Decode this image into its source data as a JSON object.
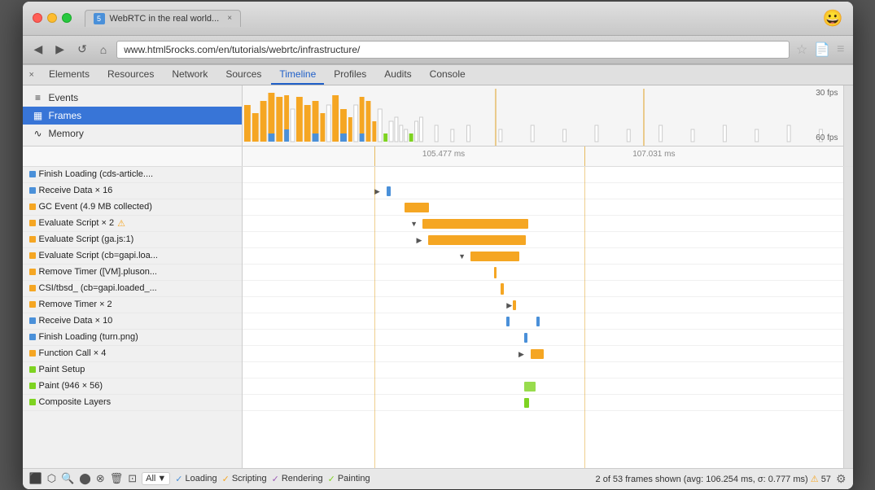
{
  "browser": {
    "tab_title": "WebRTC in the real world...",
    "tab_favicon": "5",
    "url": "www.html5rocks.com/en/tutorials/webrtc/infrastructure/",
    "emoji": "😀"
  },
  "devtools": {
    "tabs": [
      "Elements",
      "Resources",
      "Network",
      "Sources",
      "Timeline",
      "Profiles",
      "Audits",
      "Console"
    ],
    "active_tab": "Timeline"
  },
  "left_panel": {
    "items": [
      {
        "id": "events",
        "label": "Events",
        "icon": "≡"
      },
      {
        "id": "frames",
        "label": "Frames",
        "icon": "▦",
        "active": true
      },
      {
        "id": "memory",
        "label": "Memory",
        "icon": "∿"
      }
    ]
  },
  "event_list": [
    {
      "color": "blue",
      "text": "Finish Loading (cds-article...."
    },
    {
      "color": "blue",
      "text": "Receive Data × 16"
    },
    {
      "color": "orange",
      "text": "GC Event (4.9 MB collected)"
    },
    {
      "color": "orange",
      "text": "Evaluate Script × 2",
      "warning": true
    },
    {
      "color": "orange",
      "text": "Evaluate Script (ga.js:1)"
    },
    {
      "color": "orange",
      "text": "Evaluate Script (cb=gapi.loa..."
    },
    {
      "color": "orange",
      "text": "Remove Timer ([VM].pluson..."
    },
    {
      "color": "orange",
      "text": "CSI/tbsd_ (cb=gapi.loaded_..."
    },
    {
      "color": "orange",
      "text": "Remove Timer × 2"
    },
    {
      "color": "blue",
      "text": "Receive Data × 10"
    },
    {
      "color": "blue",
      "text": "Finish Loading (turn.png)"
    },
    {
      "color": "orange",
      "text": "Function Call × 4"
    },
    {
      "color": "green",
      "text": "Paint Setup"
    },
    {
      "color": "green",
      "text": "Paint (946 × 56)"
    },
    {
      "color": "green",
      "text": "Composite Layers"
    }
  ],
  "timeline": {
    "time1": "105.477 ms",
    "time2": "107.031 ms",
    "frames_shown": "2 of 53 frames shown",
    "avg": "(avg: 106.254 ms, σ: 0.777 ms)",
    "frame_count": "57"
  },
  "status_bar": {
    "filter_label": "All",
    "loading_label": "Loading",
    "scripting_label": "Scripting",
    "rendering_label": "Rendering",
    "painting_label": "Painting",
    "fps_30": "30 fps",
    "fps_60": "60 fps"
  }
}
